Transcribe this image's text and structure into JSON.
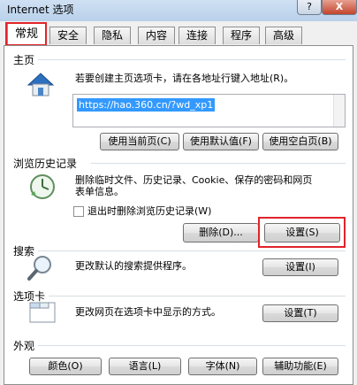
{
  "window": {
    "title": "Internet 选项",
    "help_label": "?",
    "close_label": "X"
  },
  "tabs": [
    {
      "label": "常规"
    },
    {
      "label": "安全"
    },
    {
      "label": "隐私"
    },
    {
      "label": "内容"
    },
    {
      "label": "连接"
    },
    {
      "label": "程序"
    },
    {
      "label": "高级"
    }
  ],
  "home": {
    "label": "主页",
    "description": "若要创建主页选项卡，请在各地址行键入地址(R)。",
    "url": "https://hao.360.cn/?wd_xp1",
    "buttons": {
      "current": "使用当前页(C)",
      "default": "使用默认值(F)",
      "blank": "使用空白页(B)"
    }
  },
  "history": {
    "label": "浏览历史记录",
    "description_line1": "删除临时文件、历史记录、Cookie、保存的密码和网页",
    "description_line2": "表单信息。",
    "checkbox_label": "退出时删除浏览历史记录(W)",
    "delete_button": "删除(D)...",
    "settings_button": "设置(S)"
  },
  "search": {
    "label": "搜索",
    "description": "更改默认的搜索提供程序。",
    "settings_button": "设置(I)"
  },
  "tabs_section": {
    "label": "选项卡",
    "description": "更改网页在选项卡中显示的方式。",
    "settings_button": "设置(T)"
  },
  "appearance": {
    "label": "外观",
    "buttons": {
      "colors": "颜色(O)",
      "languages": "语言(L)",
      "fonts": "字体(N)",
      "accessibility": "辅助功能(E)"
    }
  }
}
